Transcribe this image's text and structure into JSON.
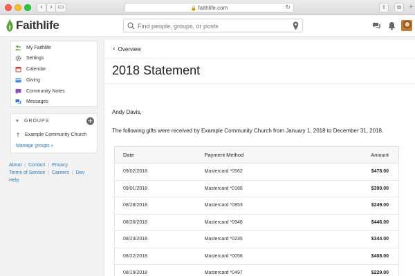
{
  "browser": {
    "url": "faithlife.com"
  },
  "header": {
    "brand": "Faithlife",
    "search_placeholder": "Find people, groups, or posts"
  },
  "sidebar": {
    "items": [
      {
        "label": "My Faithlife",
        "icon": "people-icon",
        "color": "#5a9e3a"
      },
      {
        "label": "Settings",
        "icon": "gear-icon",
        "color": "#777777"
      },
      {
        "label": "Calendar",
        "icon": "calendar-icon",
        "color": "#d9342b"
      },
      {
        "label": "Giving",
        "icon": "card-icon",
        "color": "#3b8fd6"
      },
      {
        "label": "Community Notes",
        "icon": "notes-icon",
        "color": "#8b4fb5"
      },
      {
        "label": "Messages",
        "icon": "messages-icon",
        "color": "#3a7bbf"
      }
    ],
    "groups": {
      "heading": "GROUPS",
      "items": [
        {
          "label": "Example Community Church"
        }
      ],
      "manage_label": "Manage groups »"
    },
    "footer": {
      "row1": [
        "About",
        "Contact",
        "Privacy"
      ],
      "row2": [
        "Terms of Service",
        "Careers",
        "Dev"
      ],
      "row3": [
        "Help"
      ]
    }
  },
  "main": {
    "back_label": "Overview",
    "title": "2018 Statement",
    "salutation": "Andy Davis,",
    "intro": "The following gifts were received by Example Community Church from January 1, 2018 to December 31, 2018.",
    "table": {
      "headers": {
        "date": "Date",
        "method": "Payment Method",
        "amount": "Amount"
      },
      "rows": [
        {
          "date": "09/02/2018",
          "method": "Mastercard *0562",
          "amount": "$478.00"
        },
        {
          "date": "09/01/2018",
          "method": "Mastercard *0166",
          "amount": "$390.00"
        },
        {
          "date": "08/28/2018",
          "method": "Mastercard *0853",
          "amount": "$249.00"
        },
        {
          "date": "08/26/2018",
          "method": "Mastercard *0948",
          "amount": "$446.00"
        },
        {
          "date": "08/23/2018",
          "method": "Mastercard *0235",
          "amount": "$344.00"
        },
        {
          "date": "08/22/2018",
          "method": "Mastercard *0056",
          "amount": "$408.00"
        },
        {
          "date": "08/19/2018",
          "method": "Mastercard *0497",
          "amount": "$229.00"
        }
      ]
    }
  },
  "colors": {
    "brand_green": "#5a9e3a",
    "link_blue": "#2a7ab8"
  }
}
